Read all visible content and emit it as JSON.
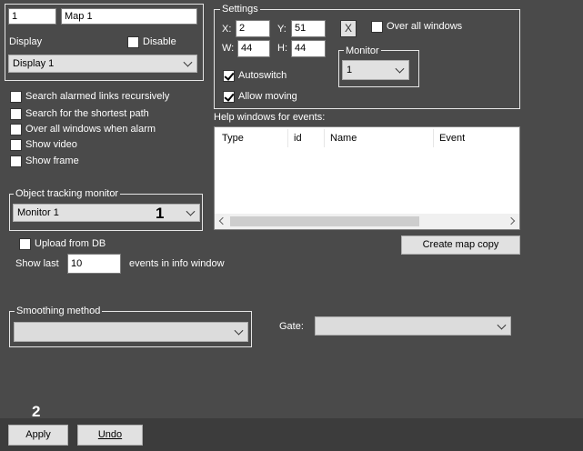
{
  "map": {
    "id": "1",
    "name": "Map 1",
    "display_label": "Display",
    "disable_label": "Disable",
    "display_value": "Display 1"
  },
  "options": [
    {
      "label": "Search alarmed links recursively",
      "checked": false
    },
    {
      "label": "Search for the shortest path",
      "checked": false
    },
    {
      "label": "Over all windows when alarm",
      "checked": false
    },
    {
      "label": "Show video",
      "checked": false
    },
    {
      "label": "Show frame",
      "checked": false
    }
  ],
  "tracking": {
    "legend": "Object tracking monitor",
    "value": "Monitor 1"
  },
  "upload_label": "Upload from DB",
  "show_last": {
    "prefix": "Show last",
    "value": "10",
    "suffix": "events in info window"
  },
  "smoothing": {
    "legend": "Smoothing method",
    "value": ""
  },
  "settings": {
    "legend": "Settings",
    "x_label": "X:",
    "x_value": "2",
    "y_label": "Y:",
    "y_value": "51",
    "w_label": "W:",
    "w_value": "44",
    "h_label": "H:",
    "h_value": "44",
    "clear_glyph": "X",
    "over_all_windows_label": "Over all windows",
    "autoswitch_label": "Autoswitch",
    "allow_moving_label": "Allow moving",
    "monitor_legend": "Monitor",
    "monitor_value": "1"
  },
  "help_windows": {
    "label": "Help windows for events:",
    "columns": [
      "Type",
      "id",
      "Name",
      "Event"
    ]
  },
  "create_map_copy_label": "Create map copy",
  "gate": {
    "label": "Gate:",
    "value": ""
  },
  "markers": {
    "one": "1",
    "two": "2"
  },
  "footer": {
    "apply_label": "Apply",
    "undo_label": "Undo"
  },
  "colors": {
    "background": "#4a4a4a",
    "footer": "#3c3c3c",
    "control": "#e1e1e1"
  }
}
